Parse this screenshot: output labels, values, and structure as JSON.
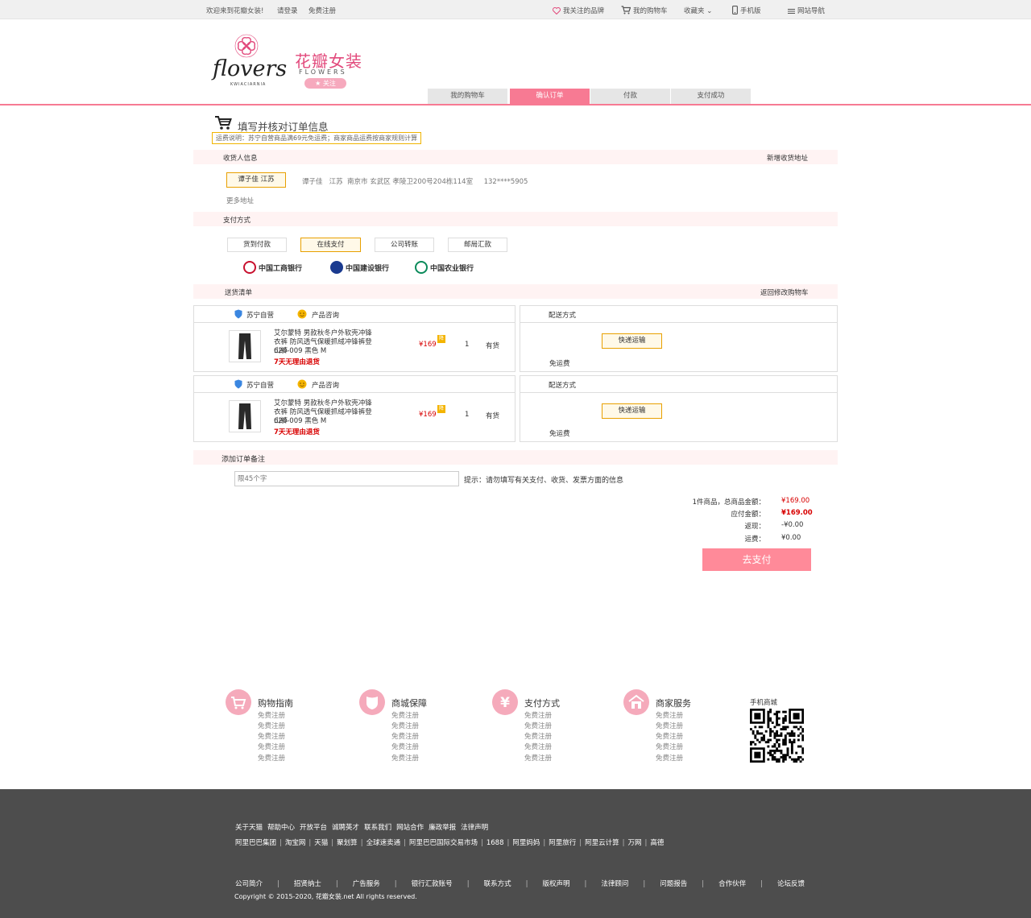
{
  "topbar": {
    "welcome": "欢迎来到花瓣女装!",
    "login": "请登录",
    "register": "免费注册",
    "favorite_brands": "我关注的品牌",
    "cart": "我的购物车",
    "favorites": "收藏夹",
    "mobile": "手机版",
    "site_nav": "网站导航"
  },
  "header": {
    "logo_text": "flovers",
    "logo_sub": "KWIACIARNIA",
    "brand_name": "花瓣女装",
    "brand_sub": "FLOWERS",
    "follow": "关注"
  },
  "steps": [
    {
      "label": "我的购物车"
    },
    {
      "label": "确认订单",
      "active": true
    },
    {
      "label": "付款"
    },
    {
      "label": "支付成功"
    }
  ],
  "page_title": "填写并核对订单信息",
  "shipping_note": "运费说明：苏宁自营商品满69元免运费；商家商品运费按商家规则计算",
  "receiver": {
    "section": "收货人信息",
    "add_address": "新增收货地址",
    "selected": "谭子佳  江苏",
    "address_line": "谭子佳   江苏  南京市 玄武区 孝陵卫200号204栋114室     132****5905",
    "more": "更多地址"
  },
  "payment": {
    "section": "支付方式",
    "options": [
      "货到付款",
      "在线支付",
      "公司转账",
      "邮局汇款"
    ],
    "selected_index": 1,
    "banks": [
      "中国工商银行",
      "中国建设银行",
      "中国农业银行"
    ],
    "bank_colors": [
      "#c8102e",
      "#1a3a8f",
      "#0a8a5a"
    ]
  },
  "delivery": {
    "section": "送货清单",
    "back_to_cart": "返回修改购物车",
    "seller": "苏宁自营",
    "consult": "产品咨询",
    "method_title": "配送方式",
    "method_button": "快递运输",
    "free_shipping": "免运费",
    "items": [
      {
        "name": "艾尔蒙特 男款秋冬户外软壳冲锋衣裤 防风透气保暖抓绒冲锋裤登山裤",
        "sku": "620-009  黑色  M",
        "promo": "7天无理由退货",
        "price": "¥169",
        "badge": "降",
        "qty": "1",
        "stock": "有货"
      },
      {
        "name": "艾尔蒙特 男款秋冬户外软壳冲锋衣裤 防风透气保暖抓绒冲锋裤登山裤",
        "sku": "620-009  黑色  M",
        "promo": "7天无理由退货",
        "price": "¥169",
        "badge": "降",
        "qty": "1",
        "stock": "有货"
      }
    ]
  },
  "remark": {
    "section": "添加订单备注",
    "placeholder": "限45个字",
    "hint": "提示：请勿填写有关支付、收货、发票方面的信息"
  },
  "summary": {
    "rows": [
      {
        "label": "1件商品，总商品金额：",
        "value": "¥169.00",
        "color": "#d80000"
      },
      {
        "label": "应付金额：",
        "value": "¥169.00",
        "color": "#d80000"
      },
      {
        "label": "返现：",
        "value": "-¥0.00",
        "color": "#333333"
      },
      {
        "label": "运费：",
        "value": "¥0.00",
        "color": "#333333"
      }
    ],
    "pay_button": "去支付"
  },
  "footer": {
    "columns": [
      {
        "title": "购物指南",
        "icon": "cart-icon",
        "links": [
          "免费注册",
          "免费注册",
          "免费注册",
          "免费注册",
          "免费注册"
        ]
      },
      {
        "title": "商城保障",
        "icon": "shield-icon",
        "links": [
          "免费注册",
          "免费注册",
          "免费注册",
          "免费注册",
          "免费注册"
        ]
      },
      {
        "title": "支付方式",
        "icon": "yen-icon",
        "links": [
          "免费注册",
          "免费注册",
          "免费注册",
          "免费注册",
          "免费注册"
        ]
      },
      {
        "title": "商家服务",
        "icon": "store-icon",
        "links": [
          "免费注册",
          "免费注册",
          "免费注册",
          "免费注册",
          "免费注册"
        ]
      }
    ],
    "mobile_store": "手机商城",
    "links_row1": [
      "关于天猫",
      "帮助中心",
      "开放平台",
      "诚聘英才",
      "联系我们",
      "网站合作",
      "廉政举报",
      "法律声明"
    ],
    "links_row2": [
      "阿里巴巴集团",
      "淘宝网",
      "天猫",
      "聚划算",
      "全球速卖通",
      "阿里巴巴国际交易市场",
      "1688",
      "阿里妈妈",
      "阿里旅行",
      "阿里云计算",
      "万网",
      "高德"
    ],
    "links_row3": [
      "公司简介",
      "招贤纳士",
      "广告服务",
      "银行汇款账号",
      "联系方式",
      "版权声明",
      "法律顾问",
      "问题报告",
      "合作伙伴",
      "论坛反馈"
    ],
    "copyright": "Copyright © 2015-2020, 花瓣女装.net All rights reserved.",
    "brand_pink": "#f77a93"
  }
}
